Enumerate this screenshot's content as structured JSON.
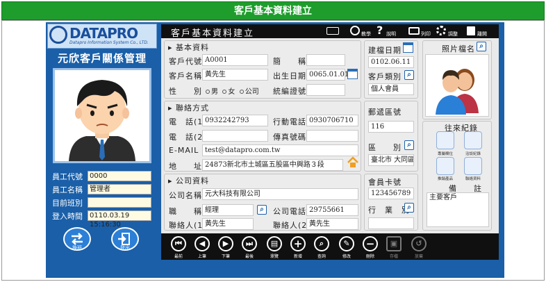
{
  "banner": "客戶基本資料建立",
  "sidebar": {
    "logo": "DATAPRO",
    "logo_sub": "Datapro Information System Co., LTD.",
    "company_title": "元欣客戶關係管理",
    "employee_id_label": "員工代號",
    "employee_id": "0000",
    "employee_name_label": "員工名稱",
    "employee_name": "管理者",
    "shift_label": "目前班別",
    "shift": "",
    "login_time_label": "登入時間",
    "login_time": "0110.03.19 15:16:30",
    "switch_label": "換班",
    "logout_label": "登出"
  },
  "header": {
    "title": "客戶基本資料建立",
    "teach_label": "教學",
    "help_label": "說明",
    "print_label": "列印",
    "settings_label": "調整",
    "leave_label": "離開"
  },
  "basic": {
    "title": "基本資料",
    "code_label": "客戶代號",
    "code": "A0001",
    "short_label": "簡　　稱",
    "short": "",
    "name_label": "客戶名稱",
    "name": "黃先生",
    "birth_label": "出生日期",
    "birth": "0065.01.01",
    "gender_label": "性　　別",
    "gender_options": [
      "男",
      "女",
      "公司"
    ],
    "tax_label": "統編證號",
    "tax": ""
  },
  "dates": {
    "created_label": "建檔日期",
    "created": "0102.06.11",
    "category_label": "客戶類別",
    "category": "個人會員"
  },
  "contact": {
    "title": "聯絡方式",
    "phone1_label": "電　話(1)",
    "phone1": "0932242793",
    "mobile_label": "行動電話",
    "mobile": "0930706710",
    "phone2_label": "電　話(2)",
    "phone2": "",
    "fax_label": "傳真號碼",
    "fax": "",
    "email_label": "E-MAIL",
    "email": "test@datapro.com.tw",
    "address_label": "地　　址",
    "address": "24873新北市土城區五股區中興路３段"
  },
  "postal": {
    "zip_label": "郵遞區號",
    "zip": "116",
    "district_label": "區　　別",
    "district": "臺北市 大同區"
  },
  "company": {
    "title": "公司資料",
    "name_label": "公司名稱",
    "name": "元大科技有限公司",
    "position_label": "職　　稱",
    "position": "經理",
    "phone_label": "公司電話",
    "phone": "29755661",
    "contact1_label": "聯絡人(1)",
    "contact1": "黃先生",
    "contact2_label": "聯絡人(2)",
    "contact2": "黃先生"
  },
  "member": {
    "card_label": "會員卡號",
    "card": "123456789",
    "industry_label": "行　業　別",
    "industry": ""
  },
  "right": {
    "photo_label": "照片檔名",
    "records_label": "往來紀錄",
    "func1": "專屬欄位",
    "func2": "洽談紀錄",
    "func3": "推銷產品",
    "func4": "聯絡資料",
    "memo_label": "備　　註",
    "memo": "主要客戶"
  },
  "toolbar": {
    "first": "最前",
    "prev": "上筆",
    "next": "下筆",
    "last": "最後",
    "browse": "瀏覽",
    "add": "新增",
    "query": "查詢",
    "edit": "修改",
    "delete": "刪除",
    "save": "存檔",
    "discard": "放棄"
  },
  "colors": {
    "banner": "#1e9d2c",
    "app_bg": "#1a5fa8",
    "toolbar": "#101010"
  }
}
